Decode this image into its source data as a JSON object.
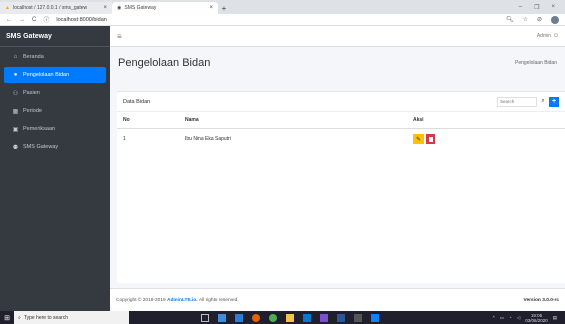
{
  "browser": {
    "tabs": [
      {
        "label": "localhost / 127.0.0.1 / sms_gatew"
      },
      {
        "label": "SMS Gateway"
      }
    ],
    "url": "localhost:8000/bidan"
  },
  "sidebar": {
    "brand": "SMS Gateway",
    "items": [
      {
        "label": "Beranda",
        "icon": "home-icon",
        "active": false
      },
      {
        "label": "Pengelolaan Bidan",
        "icon": "user-icon",
        "active": true
      },
      {
        "label": "Pasien",
        "icon": "users-icon",
        "active": false
      },
      {
        "label": "Periode",
        "icon": "table-icon",
        "active": false
      },
      {
        "label": "Pemeriksaan",
        "icon": "card-icon",
        "active": false
      },
      {
        "label": "SMS Gateway",
        "icon": "user-group-icon",
        "active": false
      }
    ]
  },
  "topnav": {
    "user": "Admin"
  },
  "page": {
    "title": "Pengelolaan Bidan",
    "breadcrumb": "Pengelolaan Bidan"
  },
  "card": {
    "title": "Data Bidan",
    "search_placeholder": "Search",
    "columns": [
      "No",
      "Nama",
      "Aksi"
    ],
    "rows": [
      {
        "no": "1",
        "nama": "Ibu Nina Eka Saputri"
      }
    ]
  },
  "footer": {
    "prefix": "Copyright © 2018-2019",
    "link": "AdminLTE.io.",
    "suffix": "All rights reserved.",
    "version": "Version 3.0.0-rc"
  },
  "taskbar": {
    "search_placeholder": "Type here to search",
    "time": "19:05",
    "date": "03/06/2020"
  },
  "colors": {
    "sidebar": "#343a40",
    "accent": "#007bff",
    "edit": "#ffc107",
    "delete": "#dc3545"
  }
}
